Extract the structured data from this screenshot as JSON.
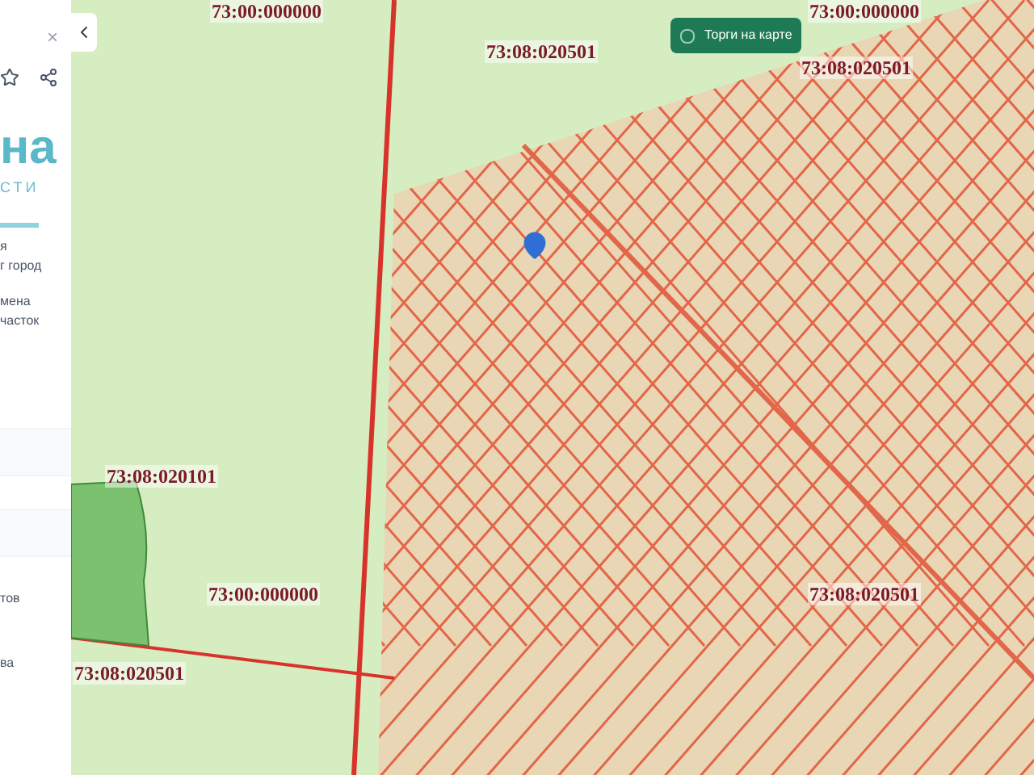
{
  "sidebar": {
    "close": "×",
    "logo_text": "на",
    "logo_subtext": "СТИ",
    "lines": [
      "я",
      "г город",
      "мена",
      "часток"
    ],
    "items": [
      "тов",
      "ва"
    ]
  },
  "map": {
    "toggle": {
      "label": "Торги на карте",
      "checked": false
    },
    "labels": [
      {
        "text": "73:00:000000"
      },
      {
        "text": "73:00:000000"
      },
      {
        "text": "73:08:020501"
      },
      {
        "text": "73:08:020501"
      },
      {
        "text": "73:08:020101"
      },
      {
        "text": "73:00:000000"
      },
      {
        "text": "73:08:020501"
      },
      {
        "text": "73:08:020501"
      }
    ]
  }
}
